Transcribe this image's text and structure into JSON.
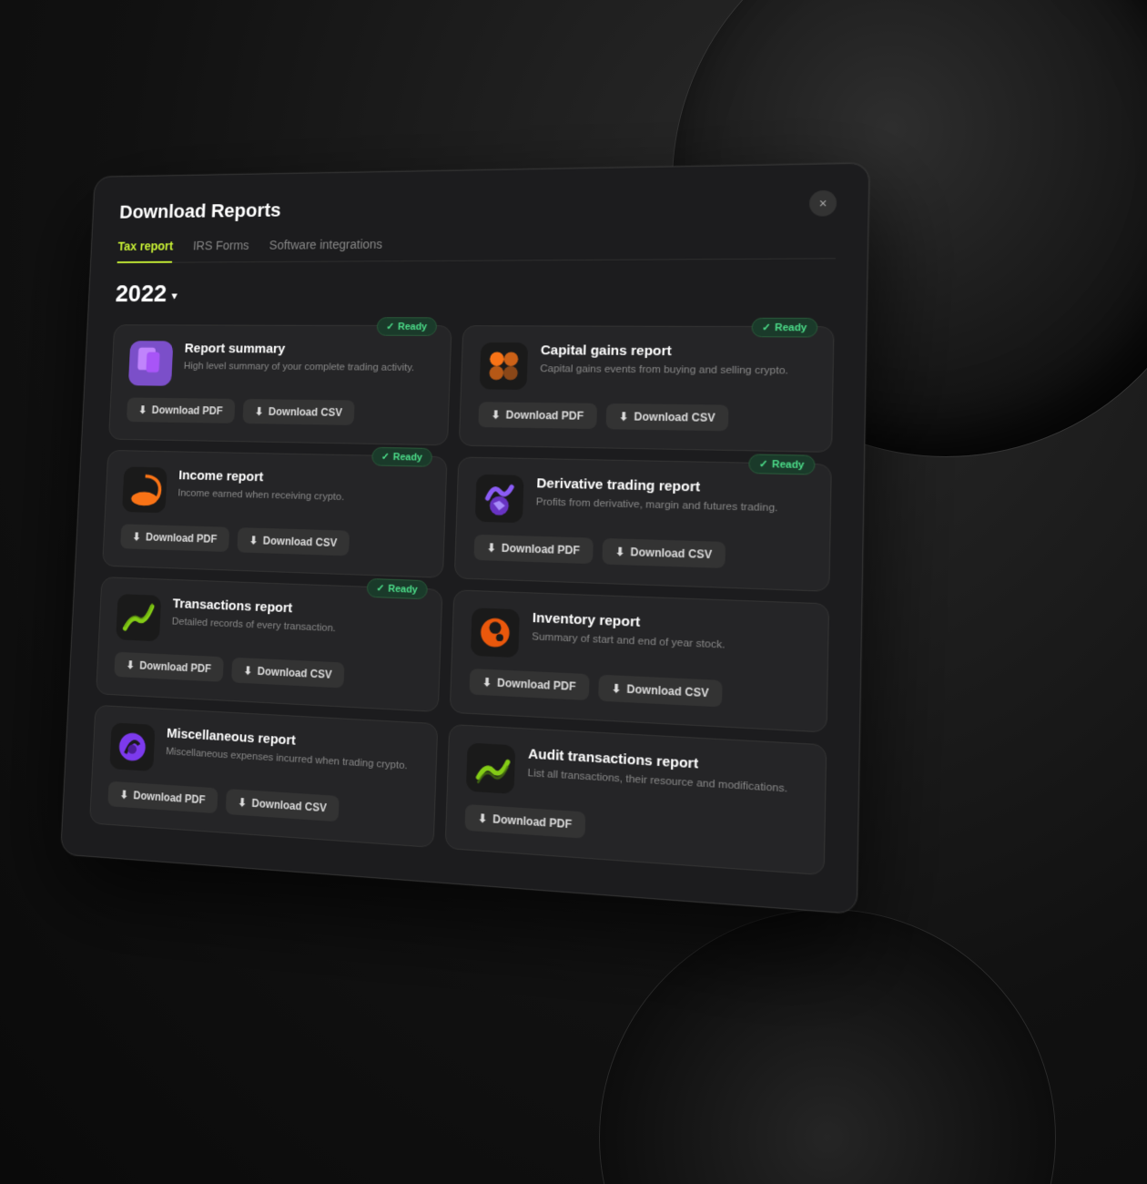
{
  "modal": {
    "title": "Download Reports",
    "close_label": "×",
    "tabs": [
      {
        "id": "tax",
        "label": "Tax report",
        "active": true
      },
      {
        "id": "irs",
        "label": "IRS Forms",
        "active": false
      },
      {
        "id": "software",
        "label": "Software integrations",
        "active": false
      }
    ],
    "year": "2022",
    "year_chevron": "▾",
    "ready_badge": "✓ Ready",
    "reports": [
      {
        "id": "report-summary",
        "title": "Report summary",
        "description": "High level summary of your complete trading activity.",
        "has_ready": true,
        "icon_color": "purple",
        "buttons": [
          "Download PDF",
          "Download CSV"
        ]
      },
      {
        "id": "capital-gains",
        "title": "Capital gains report",
        "description": "Capital gains events from buying and selling crypto.",
        "has_ready": true,
        "icon_color": "orange",
        "buttons": [
          "Download PDF",
          "Download CSV"
        ]
      },
      {
        "id": "income",
        "title": "Income report",
        "description": "Income earned when receiving crypto.",
        "has_ready": true,
        "icon_color": "orange",
        "buttons": [
          "Download PDF",
          "Download CSV"
        ]
      },
      {
        "id": "derivative",
        "title": "Derivative trading report",
        "description": "Profits from derivative, margin and futures trading.",
        "has_ready": true,
        "icon_color": "violet",
        "buttons": [
          "Download PDF",
          "Download CSV"
        ]
      },
      {
        "id": "transactions",
        "title": "Transactions report",
        "description": "Detailed records of every transaction.",
        "has_ready": true,
        "icon_color": "green",
        "buttons": [
          "Download PDF",
          "Download CSV"
        ]
      },
      {
        "id": "inventory",
        "title": "Inventory report",
        "description": "Summary of start and end of year stock.",
        "has_ready": false,
        "icon_color": "orange-dark",
        "buttons": [
          "Download PDF",
          "Download CSV"
        ]
      },
      {
        "id": "miscellaneous",
        "title": "Miscellaneous report",
        "description": "Miscellaneous expenses incurred when trading crypto.",
        "has_ready": false,
        "icon_color": "purple-dark",
        "buttons": [
          "Download PDF",
          "Download CSV"
        ]
      },
      {
        "id": "audit",
        "title": "Audit transactions report",
        "description": "List all transactions, their resource and modifications.",
        "has_ready": false,
        "icon_color": "lime",
        "buttons": [
          "Download PDF"
        ]
      }
    ]
  },
  "icons": {
    "download": "⬇"
  }
}
